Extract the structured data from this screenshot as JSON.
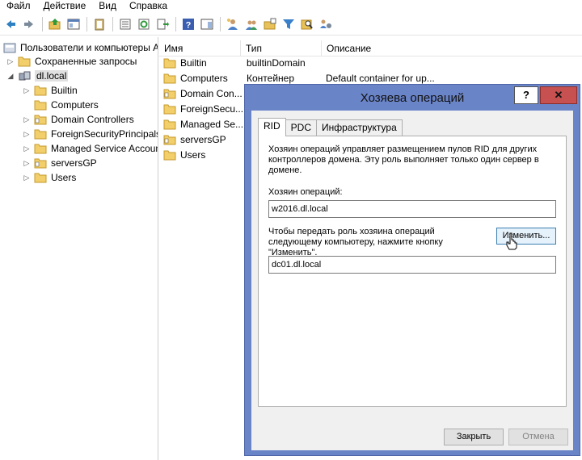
{
  "menu": [
    "Файл",
    "Действие",
    "Вид",
    "Справка"
  ],
  "toolbar_icons": [
    "back-arrow-icon",
    "forward-arrow-icon",
    "folder-up-icon",
    "console-tree-icon",
    "clipboard-icon",
    "properties-icon",
    "refresh-icon",
    "export-list-icon",
    "help-icon",
    "show-hide-pane-icon",
    "new-user-icon",
    "new-group-icon",
    "new-ou-icon",
    "filter-icon",
    "find-icon",
    "add-to-group-icon"
  ],
  "tree": {
    "root": "Пользователи и компьютеры А",
    "saved_queries": "Сохраненные запросы",
    "domain": "dl.local",
    "children": [
      "Builtin",
      "Computers",
      "Domain Controllers",
      "ForeignSecurityPrincipals",
      "Managed Service Accounts",
      "serversGP",
      "Users"
    ]
  },
  "list": {
    "columns": [
      "Имя",
      "Тип",
      "Описание"
    ],
    "rows": [
      {
        "name": "Builtin",
        "type": "builtinDomain",
        "desc": ""
      },
      {
        "name": "Computers",
        "type": "Контейнер",
        "desc": "Default container for up..."
      },
      {
        "name": "Domain Con...",
        "type": "",
        "desc": ""
      },
      {
        "name": "ForeignSecu...",
        "type": "",
        "desc": ""
      },
      {
        "name": "Managed Se...",
        "type": "",
        "desc": ""
      },
      {
        "name": "serversGP",
        "type": "",
        "desc": ""
      },
      {
        "name": "Users",
        "type": "",
        "desc": ""
      }
    ]
  },
  "dialog": {
    "title": "Хозяева операций",
    "help_label": "?",
    "close_label": "✕",
    "tabs": [
      "RID",
      "PDC",
      "Инфраструктура"
    ],
    "description": "Хозяин операций управляет размещением пулов RID для других контроллеров домена. Эту роль выполняет только один сервер в домене.",
    "master_label": "Хозяин операций:",
    "master_value": "w2016.dl.local",
    "transfer_text": "Чтобы передать роль хозяина операций следующему компьютеру, нажмите кнопку \"Изменить\".",
    "change_button": "Изменить...",
    "target_value": "dc01.dl.local",
    "close_button": "Закрыть",
    "cancel_button": "Отмена"
  }
}
